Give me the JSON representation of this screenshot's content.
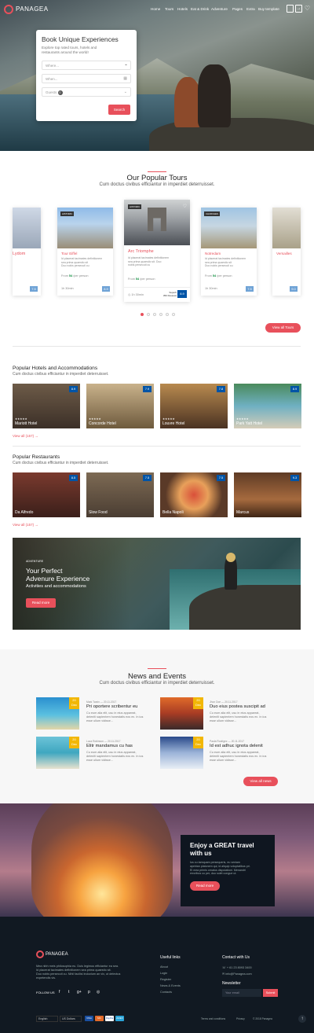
{
  "brand": {
    "name": "PANAGEA",
    "accent": "#e8505b",
    "score_color": "#0054a6"
  },
  "nav": {
    "items": [
      "Home",
      "Tours",
      "Hotels",
      "Eat & Drink",
      "Adventure",
      "Pages",
      "Extra",
      "Buy template"
    ]
  },
  "top_icons": [
    "cart-icon",
    "login-icon",
    "heart-icon"
  ],
  "booking": {
    "title": "Book Unique Experiences",
    "desc_line1": "Explore top rated tours, hotels and",
    "desc_line2": "restaurants around the world!",
    "where_placeholder": "Where...",
    "when_placeholder": "When...",
    "guests_label": "Guests",
    "guests_count": "0",
    "search_label": "Search"
  },
  "tours": {
    "title": "Our Popular Tours",
    "subtitle": "Cum doctus civibus efficiantur in imperdiet deterruisset.",
    "cards": [
      {
        "name": "Lydom",
        "badge": "",
        "desc": [
          "Id placerat tacimates definitionem",
          "sea prima quaestio sit",
          "Duo nobis persecuti cu"
        ],
        "price": "54",
        "duration": "1h 30min",
        "score": "7.5"
      },
      {
        "name": "Tour Eiffel",
        "badge": "HISTORIC",
        "desc": [
          "Id placerat tacimates definitionem",
          "sea prima quaestio sit",
          "Duo nobis persecuti cu"
        ],
        "price": "54",
        "duration": "1h 30min",
        "score": "8.9"
      },
      {
        "name": "Arc Triomphe",
        "badge": "HISTORIC",
        "desc": [
          "Id placerat tacimates definitionem",
          "sea prima quaestio sit. Duo",
          "nobis persecuti cu"
        ],
        "price": "54",
        "duration": "1h 30min",
        "rating_word": "Superb",
        "rating_count": "350 Reviews",
        "score": "8.9"
      },
      {
        "name": "Notredam",
        "badge": "CHURCHES",
        "desc": [
          "Id placerat tacimates definitionem",
          "sea prima quaestio sit",
          "Duo nobis persecuti cu"
        ],
        "price": "54",
        "duration": "1h 30min",
        "score": "7.5"
      },
      {
        "name": "Versailles",
        "badge": "HISTORIC",
        "desc": [
          "Id placerat tacimates definitionem",
          "sea prima quaestio sit",
          "Duo nobis persecuti cu"
        ],
        "price": "54",
        "duration": "1h 30min",
        "score": "9.0"
      }
    ],
    "price_prefix": "From",
    "price_suffix": "/per person",
    "view_all": "View all Tours"
  },
  "hotels": {
    "title": "Popular Hotels and Accommodations",
    "subtitle": "Cum doctus civibus efficiantur in imperdiet deterruisset.",
    "items": [
      {
        "name": "Mariott Hotel",
        "score": "8.9"
      },
      {
        "name": "Concorde Hotel",
        "score": "7.9"
      },
      {
        "name": "Louvre Hotel",
        "score": "7.8"
      },
      {
        "name": "Park Yatt Hotel",
        "score": "8.9"
      }
    ],
    "stars": "★★★★★",
    "view_all": "View all (157) →"
  },
  "restaurants": {
    "title": "Popular Restaurants",
    "subtitle": "Cum doctus civibus efficiantur in imperdiet deterruisset.",
    "items": [
      {
        "name": "Da Alfredo",
        "score": "8.5"
      },
      {
        "name": "Slow Food",
        "score": "7.5"
      },
      {
        "name": "Bella Napoli",
        "score": "7.5"
      },
      {
        "name": "Marcus",
        "score": "9.3"
      }
    ],
    "view_all": "View all (157) →"
  },
  "adventure": {
    "kicker": "ADVENTURE",
    "title_line1": "Your Perfect",
    "title_line2": "Advenure Experience",
    "subtitle": "Activities and accommodations",
    "button": "Read more"
  },
  "news": {
    "title": "News and Events",
    "subtitle": "Cum doctus civibus efficiantur in imperdiet deterruisset.",
    "items": [
      {
        "day": "20",
        "month": "Dec",
        "author": "Mark Twain",
        "date": "20.11.2017",
        "title": "Pri oportere scribentur eu",
        "text": [
          "Cu eum alia elit, usu in eius appareat,",
          "deleniti sapientem honestatis eos ex. In ius",
          "esse ullum vidisse..."
        ]
      },
      {
        "day": "20",
        "month": "Dec",
        "author": "Jhon Doe",
        "date": "20.11.2017",
        "title": "Duo eius postea suscipit ad",
        "text": [
          "Cu eum alia elit, usu in eius appareat,",
          "deleniti sapientem honestatis eos ex. In ius",
          "esse ullum vidisse..."
        ]
      },
      {
        "day": "20",
        "month": "Dec",
        "author": "Luca Robinson",
        "date": "20.11.2017",
        "title": "Elitr mandamus cu has",
        "text": [
          "Cu eum alia elit, usu in eius appareat,",
          "deleniti sapientem honestatis eos ex. In ius",
          "esse ullum vidisse..."
        ]
      },
      {
        "day": "20",
        "month": "Dec",
        "author": "Paula Rodrigez",
        "date": "20.11.2017",
        "title": "Id est adhuc ignota delenit",
        "text": [
          "Cu eum alia elit, usu in eius appareat,",
          "deleniti sapientem honestatis eos ex. In ius",
          "esse ullum vidisse..."
        ]
      }
    ],
    "view_all": "View all news"
  },
  "promo": {
    "title_line1": "Enjoy a GREAT travel",
    "title_line2": "with us",
    "text": [
      "Ius cu tamquam persequeris, eu veniam",
      "apeirian platonem qui, id aliquip voluptatibus pri.",
      "Ei mea primis ornatus disputationi. Menandri",
      "erroribus cu per, duo solet congue ut."
    ],
    "button": "Read more"
  },
  "footer": {
    "about": [
      "Mea nibh meis philosophia eu. Duis legimus efficiantur ea sea.",
      "Id placerat tacimates definitionem sea prima quaestio sit.",
      "Duo nobis persecuti cu. Nihil facilisi indoctum an vix, ut delectus",
      "expetendis vis."
    ],
    "follow_label": "FOLLOW US",
    "social": [
      "facebook-icon",
      "twitter-icon",
      "google-plus-icon",
      "pinterest-icon",
      "instagram-icon"
    ],
    "useful_title": "Useful links",
    "useful_links": [
      "About",
      "Login",
      "Register",
      "News & Events",
      "Contacts"
    ],
    "contact_title": "Contact with Us",
    "phone": "+ 61 23 8093 3400",
    "email": "info@Panagea.com",
    "newsletter_title": "Newsletter",
    "newsletter_placeholder": "Your email",
    "newsletter_button": "Submit",
    "language": "English",
    "currency": "US Dollars",
    "payments": [
      "VISA",
      "MC",
      "PayPal",
      "AMEX"
    ],
    "terms": "Terms and conditions",
    "privacy": "Privacy",
    "copyright": "© 2018 Panagea"
  }
}
